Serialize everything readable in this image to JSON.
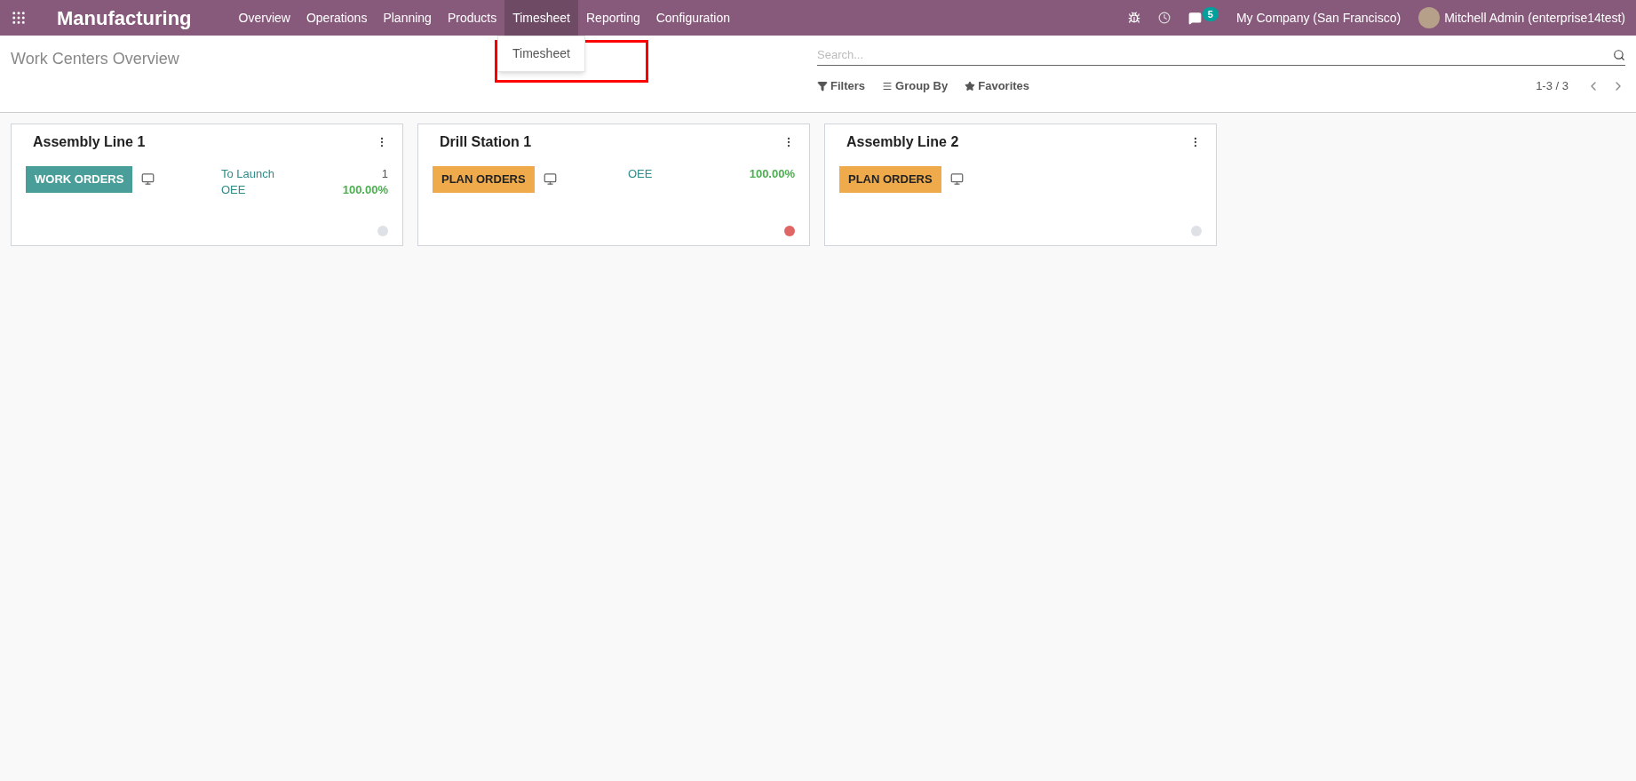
{
  "navbar": {
    "app_name": "Manufacturing",
    "menu": [
      {
        "label": "Overview",
        "selected": false
      },
      {
        "label": "Operations",
        "selected": false
      },
      {
        "label": "Planning",
        "selected": false
      },
      {
        "label": "Products",
        "selected": false
      },
      {
        "label": "Timesheet",
        "selected": true
      },
      {
        "label": "Reporting",
        "selected": false
      },
      {
        "label": "Configuration",
        "selected": false
      }
    ],
    "dropdown": {
      "items": [
        "Timesheet"
      ]
    },
    "messages_badge": "5",
    "company": "My Company (San Francisco)",
    "user": "Mitchell Admin (enterprise14test)"
  },
  "control_panel": {
    "title": "Work Centers Overview",
    "search": {
      "placeholder": "Search..."
    },
    "filters": [
      "Filters",
      "Group By",
      "Favorites"
    ],
    "pager": "1-3 / 3"
  },
  "cards": [
    {
      "title": "Assembly Line 1",
      "button": {
        "label": "WORK ORDERS",
        "kind": "primary"
      },
      "stats": [
        {
          "label": "To Launch",
          "value": "1",
          "kind": "count"
        },
        {
          "label": "OEE",
          "value": "100.00%",
          "kind": "percent"
        }
      ],
      "color": "#dee2e6"
    },
    {
      "title": "Drill Station 1",
      "button": {
        "label": "PLAN ORDERS",
        "kind": "warning"
      },
      "stats": [
        {
          "label": "OEE",
          "value": "100.00%",
          "kind": "percent"
        }
      ],
      "color": "#e06666"
    },
    {
      "title": "Assembly Line 2",
      "button": {
        "label": "PLAN ORDERS",
        "kind": "warning"
      },
      "color": "#dee2e6"
    }
  ]
}
